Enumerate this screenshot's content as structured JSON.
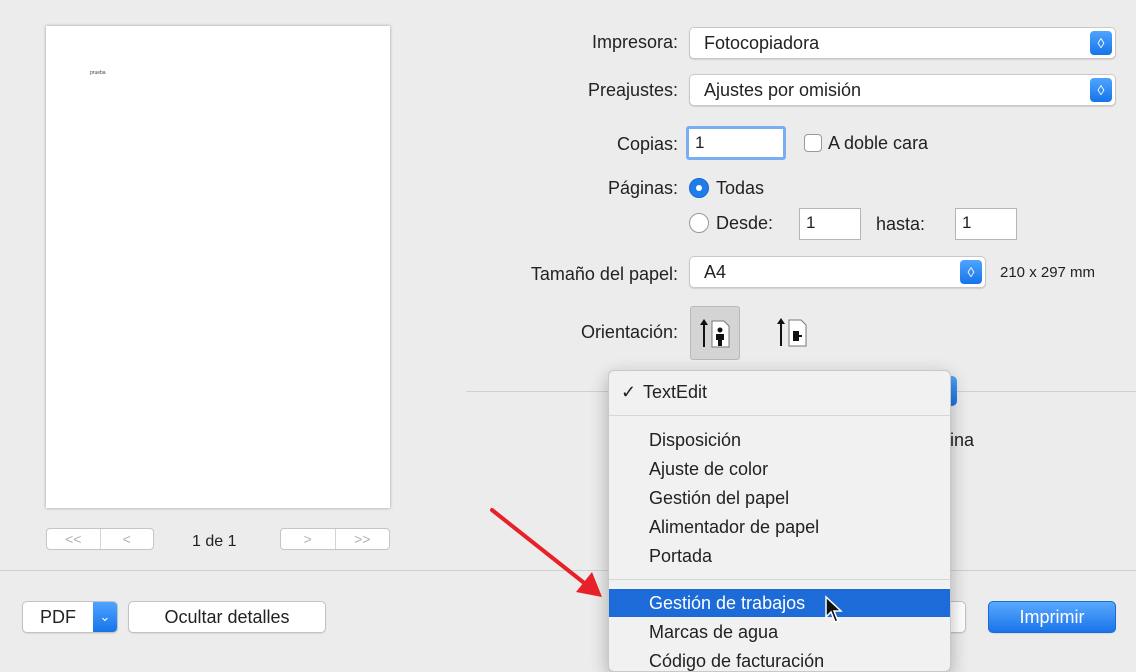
{
  "preview": {
    "page_text": "prueba",
    "page_indicator": "1 de 1",
    "nav_first": "<<",
    "nav_prev": "<",
    "nav_next": ">",
    "nav_last": ">>"
  },
  "form": {
    "printer_label": "Impresora:",
    "printer_value": "Fotocopiadora",
    "presets_label": "Preajustes:",
    "presets_value": "Ajustes por omisión",
    "copies_label": "Copias:",
    "copies_value": "1",
    "two_sided_label": "A doble cara",
    "two_sided_checked": false,
    "pages_label": "Páginas:",
    "pages_all_label": "Todas",
    "pages_all_selected": true,
    "pages_from_label": "Desde:",
    "pages_from_value": "1",
    "pages_to_label": "hasta:",
    "pages_to_value": "1",
    "paper_size_label": "Tamaño del papel:",
    "paper_size_value": "A4",
    "paper_size_dims": "210 x 297 mm",
    "orientation_label": "Orientación:",
    "obscured_text_fragment": "ina"
  },
  "menu": {
    "checked_item": "TextEdit",
    "items_group1": [
      "Disposición",
      "Ajuste de color",
      "Gestión del papel",
      "Alimentador de papel",
      "Portada"
    ],
    "highlighted_item": "Gestión de trabajos",
    "items_group2": [
      "Marcas de agua",
      "Código de facturación"
    ]
  },
  "footer": {
    "pdf_label": "PDF",
    "hide_details_label": "Ocultar detalles",
    "print_label": "Imprimir"
  },
  "colors": {
    "accent": "#1f7ceb",
    "highlight": "#1c6bd8",
    "annotation_arrow": "#e8202a"
  }
}
